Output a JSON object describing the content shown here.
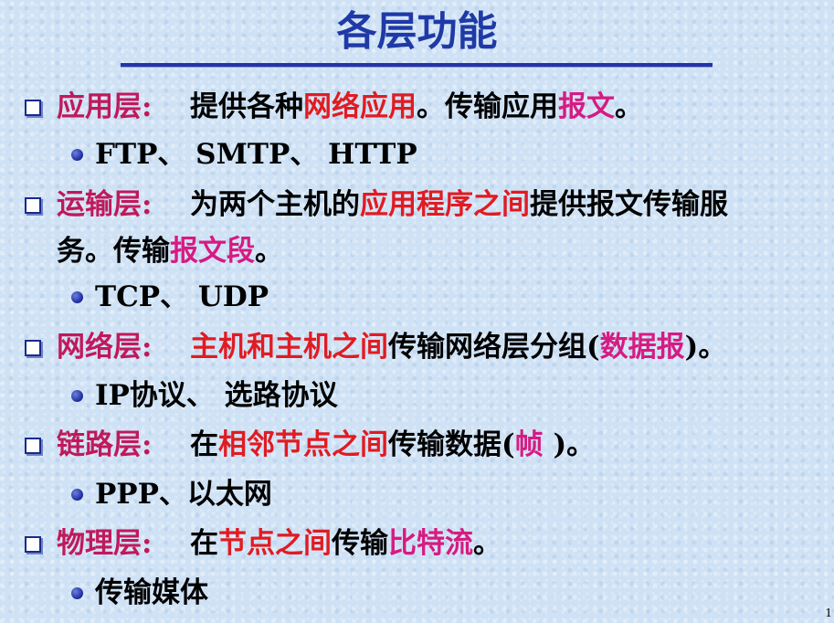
{
  "title": "各层功能",
  "page_number": "1",
  "layers": [
    {
      "label": "应用层:",
      "desc": [
        {
          "text": "提供各种",
          "style": "plain"
        },
        {
          "text": "网络应用",
          "style": "red"
        },
        {
          "text": "。传输应用",
          "style": "plain"
        },
        {
          "text": "报文",
          "style": "pink"
        },
        {
          "text": "。",
          "style": "plain"
        }
      ],
      "sub": "FTP、 SMTP、 HTTP"
    },
    {
      "label": "运输层:",
      "desc": [
        {
          "text": "为两个主机的",
          "style": "plain"
        },
        {
          "text": "应用程序之间",
          "style": "red"
        },
        {
          "text": "提供报文传输服",
          "style": "plain"
        }
      ],
      "desc2": [
        {
          "text": "务。传输",
          "style": "plain"
        },
        {
          "text": "报文段",
          "style": "pink"
        },
        {
          "text": "。",
          "style": "plain"
        }
      ],
      "sub": "TCP、 UDP"
    },
    {
      "label": "网络层:",
      "desc": [
        {
          "text": "主机和主机之间",
          "style": "red"
        },
        {
          "text": "传输网络层分组(",
          "style": "plain"
        },
        {
          "text": "数据报",
          "style": "pink"
        },
        {
          "text": ")。",
          "style": "plain"
        }
      ],
      "sub": "IP协议、 选路协议"
    },
    {
      "label": "链路层:",
      "desc": [
        {
          "text": " 在",
          "style": "plain"
        },
        {
          "text": "相邻节点之间",
          "style": "red"
        },
        {
          "text": "传输数据(",
          "style": "plain"
        },
        {
          "text": "帧",
          "style": "pink"
        },
        {
          "text": " )。",
          "style": "plain"
        }
      ],
      "sub": "PPP、以太网"
    },
    {
      "label": "物理层:",
      "desc": [
        {
          "text": "在",
          "style": "plain"
        },
        {
          "text": "节点之间",
          "style": "red"
        },
        {
          "text": "传输",
          "style": "plain"
        },
        {
          "text": "比特流",
          "style": "pink"
        },
        {
          "text": "。",
          "style": "plain"
        }
      ],
      "sub": "传输媒体"
    }
  ]
}
